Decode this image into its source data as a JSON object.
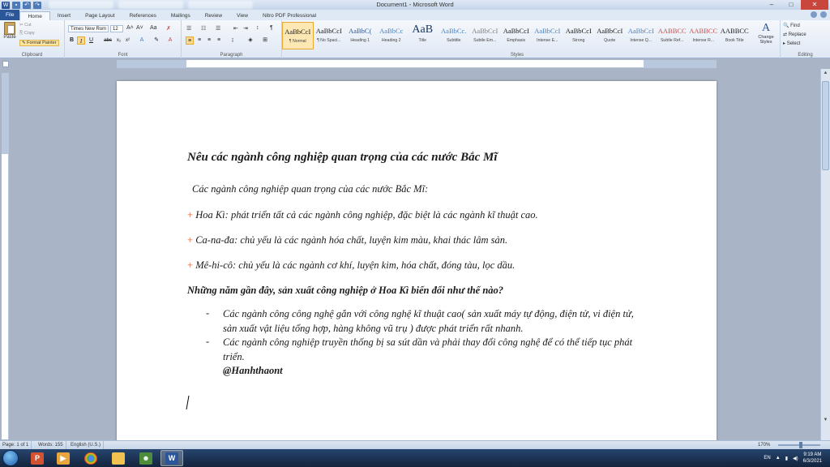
{
  "window": {
    "title": "Document1 - Microsoft Word",
    "controls": [
      "–",
      "□",
      "✕"
    ]
  },
  "ribbon_tabs": [
    "File",
    "Home",
    "Insert",
    "Page Layout",
    "References",
    "Mailings",
    "Review",
    "View",
    "Nitro PDF Professional"
  ],
  "clipboard": {
    "paste": "Paste",
    "cut": "Cut",
    "copy": "Copy",
    "format_painter": "Format Painter",
    "group_label": "Clipboard"
  },
  "font": {
    "name": "Times New Rom",
    "size": "12",
    "group_label": "Font"
  },
  "paragraph": {
    "group_label": "Paragraph"
  },
  "styles": {
    "group_label": "Styles",
    "items": [
      {
        "sample": "AaBbCcI",
        "name": "¶ Normal",
        "color": "#1a1a1a"
      },
      {
        "sample": "AaBbCcI",
        "name": "¶ No Spaci...",
        "color": "#1a1a1a"
      },
      {
        "sample": "AaBbC(",
        "name": "Heading 1",
        "color": "#2e5597"
      },
      {
        "sample": "AaBbCc",
        "name": "Heading 2",
        "color": "#4f81bd"
      },
      {
        "sample": "AaB",
        "name": "Title",
        "color": "#17365d"
      },
      {
        "sample": "AaBbCc.",
        "name": "Subtitle",
        "color": "#4f81bd"
      },
      {
        "sample": "AaBbCcI",
        "name": "Subtle Em...",
        "color": "#7f7f7f"
      },
      {
        "sample": "AaBbCcI",
        "name": "Emphasis",
        "color": "#1a1a1a"
      },
      {
        "sample": "AaBbCcI",
        "name": "Intense E...",
        "color": "#4f81bd"
      },
      {
        "sample": "AaBbCcI",
        "name": "Strong",
        "color": "#1a1a1a"
      },
      {
        "sample": "AaBbCcI",
        "name": "Quote",
        "color": "#1a1a1a"
      },
      {
        "sample": "AaBbCcI",
        "name": "Intense Q...",
        "color": "#4f81bd"
      },
      {
        "sample": "AABBCC",
        "name": "Subtle Ref...",
        "color": "#c0504d"
      },
      {
        "sample": "AABBCC",
        "name": "Intense R...",
        "color": "#c0504d"
      },
      {
        "sample": "AABBCC",
        "name": "Book Title",
        "color": "#1a1a1a"
      }
    ],
    "change_styles": "Change Styles"
  },
  "editing": {
    "find": "Find",
    "replace": "Replace",
    "select": "Select",
    "group_label": "Editing"
  },
  "document": {
    "heading": "Nêu các ngành công nghiệp quan trọng của các nước Bắc Mĩ",
    "intro": "Các ngành công nghiệp quan trọng của các nước Bắc Mĩ:",
    "items": [
      "Hoa Kì: phát triển tất cả các ngành công nghiệp, đặc biệt là các ngành kĩ thuật cao.",
      "Ca-na-đa: chủ yếu là các ngành hóa chất, luyện kim màu, khai thác lâm sản.",
      "Mê-hi-cô: chủ yếu là các ngành cơ khí, luyện kim, hóa chất, đóng tàu, lọc dầu."
    ],
    "question": "Những năm gần đây, sản xuất công nghiệp ở Hoa Kì biến đổi như thế nào?",
    "answers": [
      "Các ngành công công nghệ gắn với công nghệ kĩ thuật cao( sản xuất máy tự động, điện tử, vi điện tử, sản xuất vật liệu tổng hợp, hàng không vũ trụ ) được phát triển rất nhanh.",
      "Các ngành công nghiệp truyền thống bị sa sút dần và phải thay đổi công nghệ để có thể tiếp tục phát triển."
    ],
    "signature": "@Hanhthaont"
  },
  "status": {
    "page": "Page: 1 of 1",
    "words": "Words: 155",
    "language": "English (U.S.)",
    "zoom": "170%"
  },
  "taskbar": {
    "lang": "EN",
    "time": "9:19 AM",
    "date": "6/3/2021"
  }
}
